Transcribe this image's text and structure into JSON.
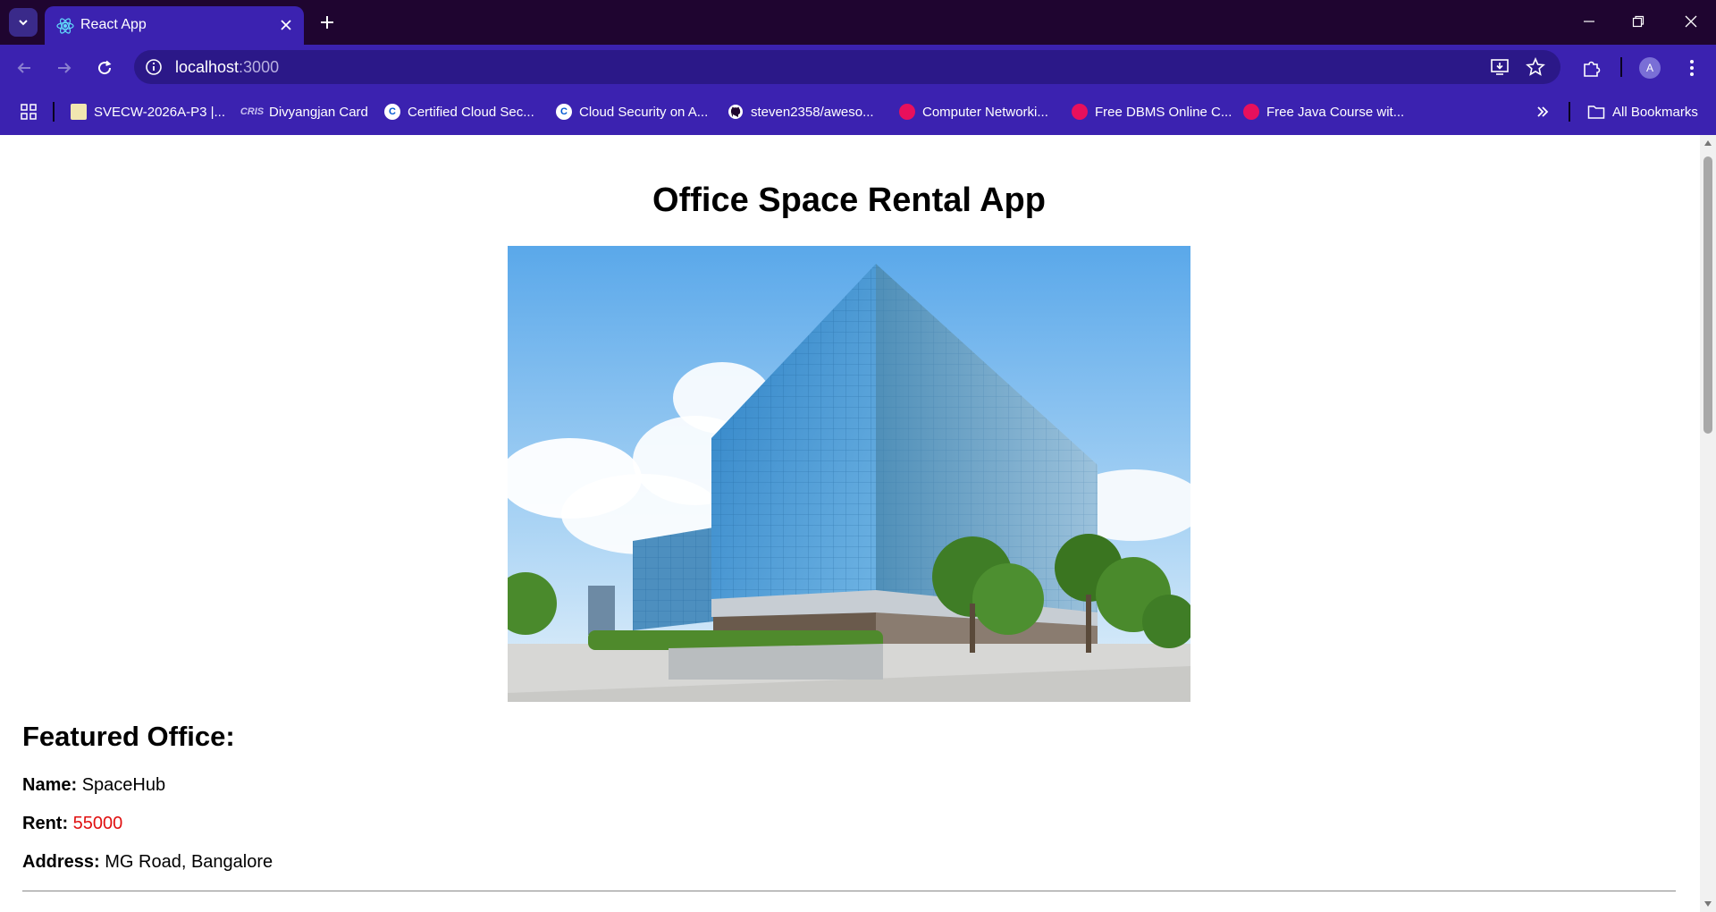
{
  "browser": {
    "tab_title": "React App",
    "url_host": "localhost",
    "url_port": ":3000",
    "profile_initial": "A",
    "bookmarks": [
      {
        "label": "SVECW-2026A-P3 |...",
        "icon": "college-icon"
      },
      {
        "label": "Divyangjan Card",
        "icon": "cris-icon",
        "badge": "CRIS"
      },
      {
        "label": "Certified Cloud Sec...",
        "icon": "coursera-icon",
        "badge": "C"
      },
      {
        "label": "Cloud Security on A...",
        "icon": "coursera-icon",
        "badge": "C"
      },
      {
        "label": "steven2358/aweso...",
        "icon": "github-icon"
      },
      {
        "label": "Computer Networki...",
        "icon": "testbook-icon"
      },
      {
        "label": "Free DBMS Online C...",
        "icon": "testbook-icon"
      },
      {
        "label": "Free Java Course wit...",
        "icon": "testbook-icon"
      }
    ],
    "all_bookmarks_label": "All Bookmarks"
  },
  "page": {
    "heading": "Office Space Rental App",
    "featured_heading": "Featured Office:",
    "name_label": "Name:",
    "name_value": "SpaceHub",
    "rent_label": "Rent:",
    "rent_value": "55000",
    "address_label": "Address:",
    "address_value": "MG Road, Bangalore"
  },
  "colors": {
    "chrome_dark": "#1f0530",
    "chrome_accent": "#3b22b0",
    "rent_value": "#e01010"
  }
}
